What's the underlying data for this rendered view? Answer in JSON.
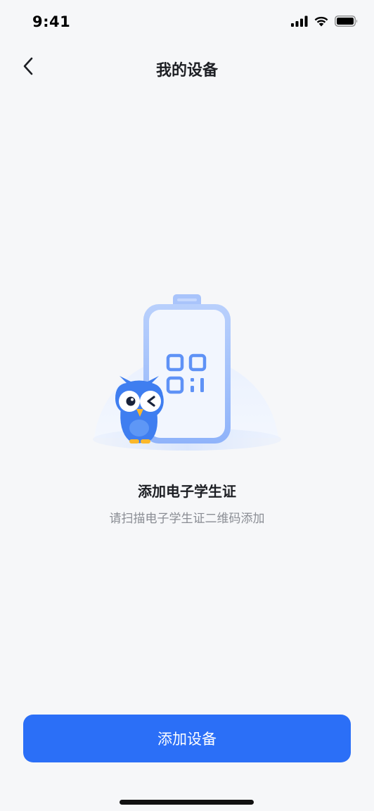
{
  "status_bar": {
    "time": "9:41",
    "icons": [
      "signal-icon",
      "wifi-icon",
      "battery-icon"
    ]
  },
  "nav": {
    "title": "我的设备",
    "back_icon": "chevron-left-icon"
  },
  "empty_state": {
    "illustration": "owl-mascot-with-qr-card",
    "title": "添加电子学生证",
    "subtitle": "请扫描电子学生证二维码添加"
  },
  "primary_action": {
    "label": "添加设备"
  },
  "colors": {
    "background": "#f6f7f9",
    "accent": "#2b6ff7",
    "title_text": "#1d1f24",
    "secondary_text": "#8a8d94"
  }
}
